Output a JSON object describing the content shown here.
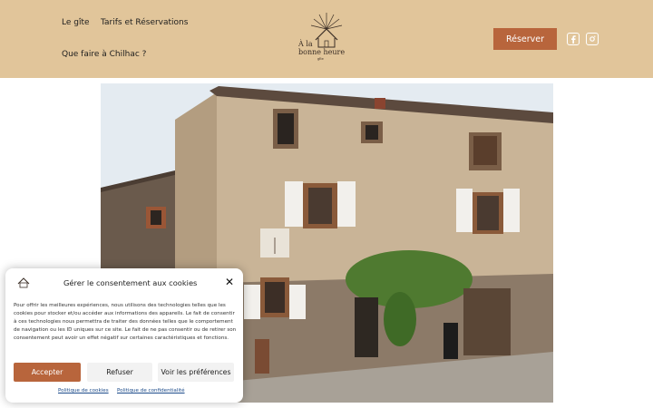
{
  "header": {
    "nav": [
      "Le gîte",
      "Tarifs et Réservations",
      "Que faire à Chilhac ?"
    ],
    "logo": {
      "line1": "À la",
      "line2": "bonne heure",
      "line3": "gîte"
    },
    "reserve_label": "Réserver",
    "social_icons": [
      "facebook-icon",
      "instagram-icon"
    ]
  },
  "cookie": {
    "title": "Gérer le consentement aux cookies",
    "body": "Pour offrir les meilleures expériences, nous utilisons des technologies telles que les cookies pour stocker et/ou accéder aux informations des appareils. Le fait de consentir à ces technologies nous permettra de traiter des données telles que le comportement de navigation ou les ID uniques sur ce site. Le fait de ne pas consentir ou de retirer son consentement peut avoir un effet négatif sur certaines caractéristiques et fonctions.",
    "accept": "Accepter",
    "refuse": "Refuser",
    "prefs": "Voir les préférences",
    "cookie_policy": "Politique de cookies",
    "privacy_policy": "Politique de confidentialité"
  },
  "colors": {
    "header_bg": "#e1c59a",
    "accent": "#b8653c",
    "text": "#1e1e1e"
  }
}
